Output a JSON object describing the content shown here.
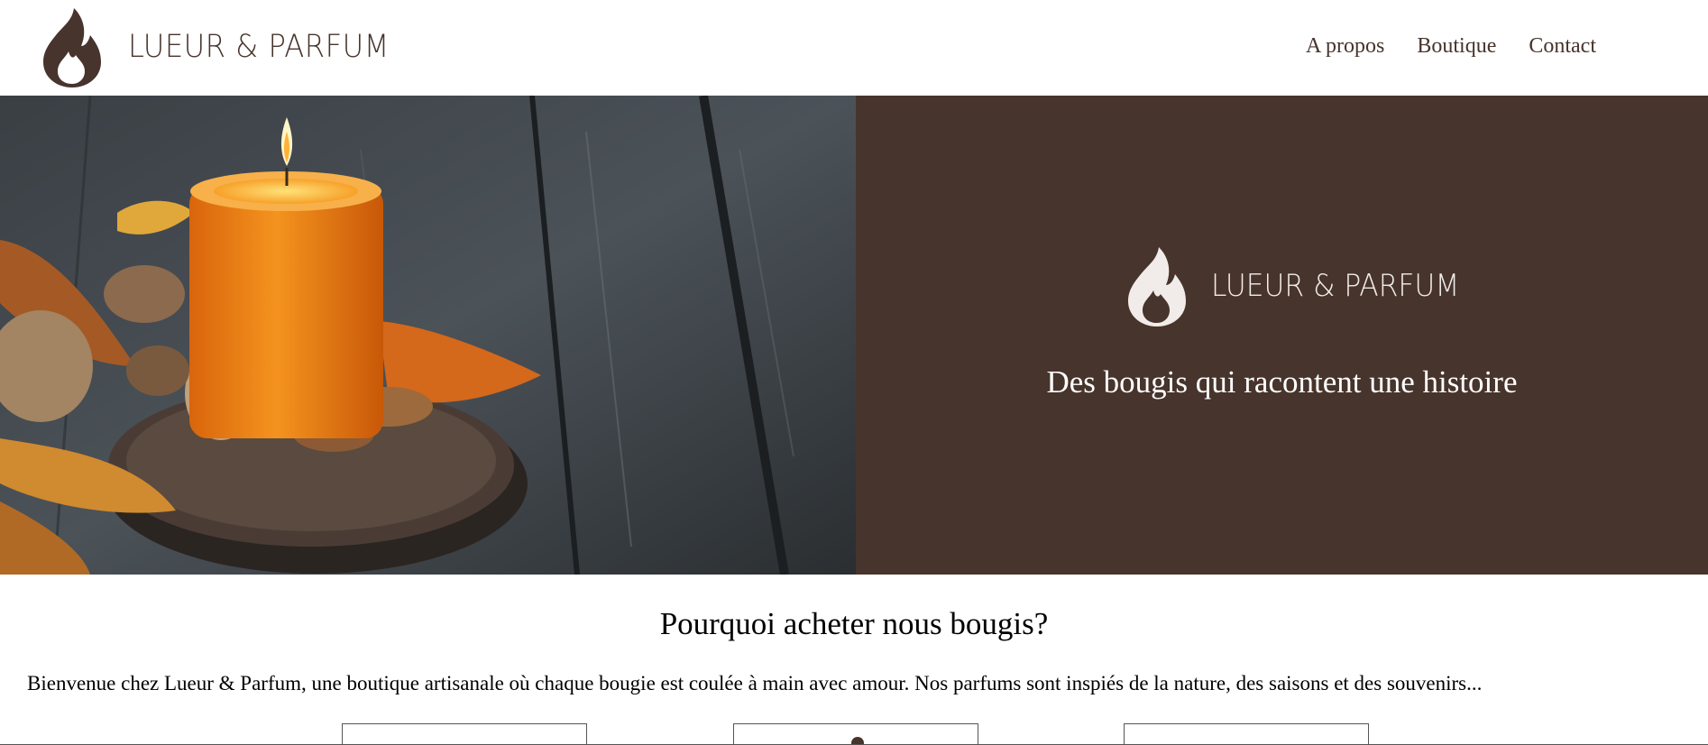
{
  "brand": {
    "name": "LUEUR & PARFUM",
    "primary_color": "#47342c",
    "light_color": "#f1ecea",
    "logo_icon": "flame-icon"
  },
  "nav": {
    "items": [
      {
        "label": "A propos"
      },
      {
        "label": "Boutique"
      },
      {
        "label": "Contact"
      }
    ]
  },
  "hero": {
    "image": "photo of an orange candle on a wooden tray with walnuts, almonds and autumn leaves on dark wood",
    "brand_name": "LUEUR & PARFUM",
    "tagline": "Des bougis qui racontent une histoire"
  },
  "why": {
    "title": "Pourquoi acheter nous bougis?",
    "intro": "Bienvenue chez Lueur & Parfum, une boutique artisanale où chaque bougie est coulée à main avec amour. Nos parfums sont inspiés de la nature, des saisons et des souvenirs..."
  }
}
